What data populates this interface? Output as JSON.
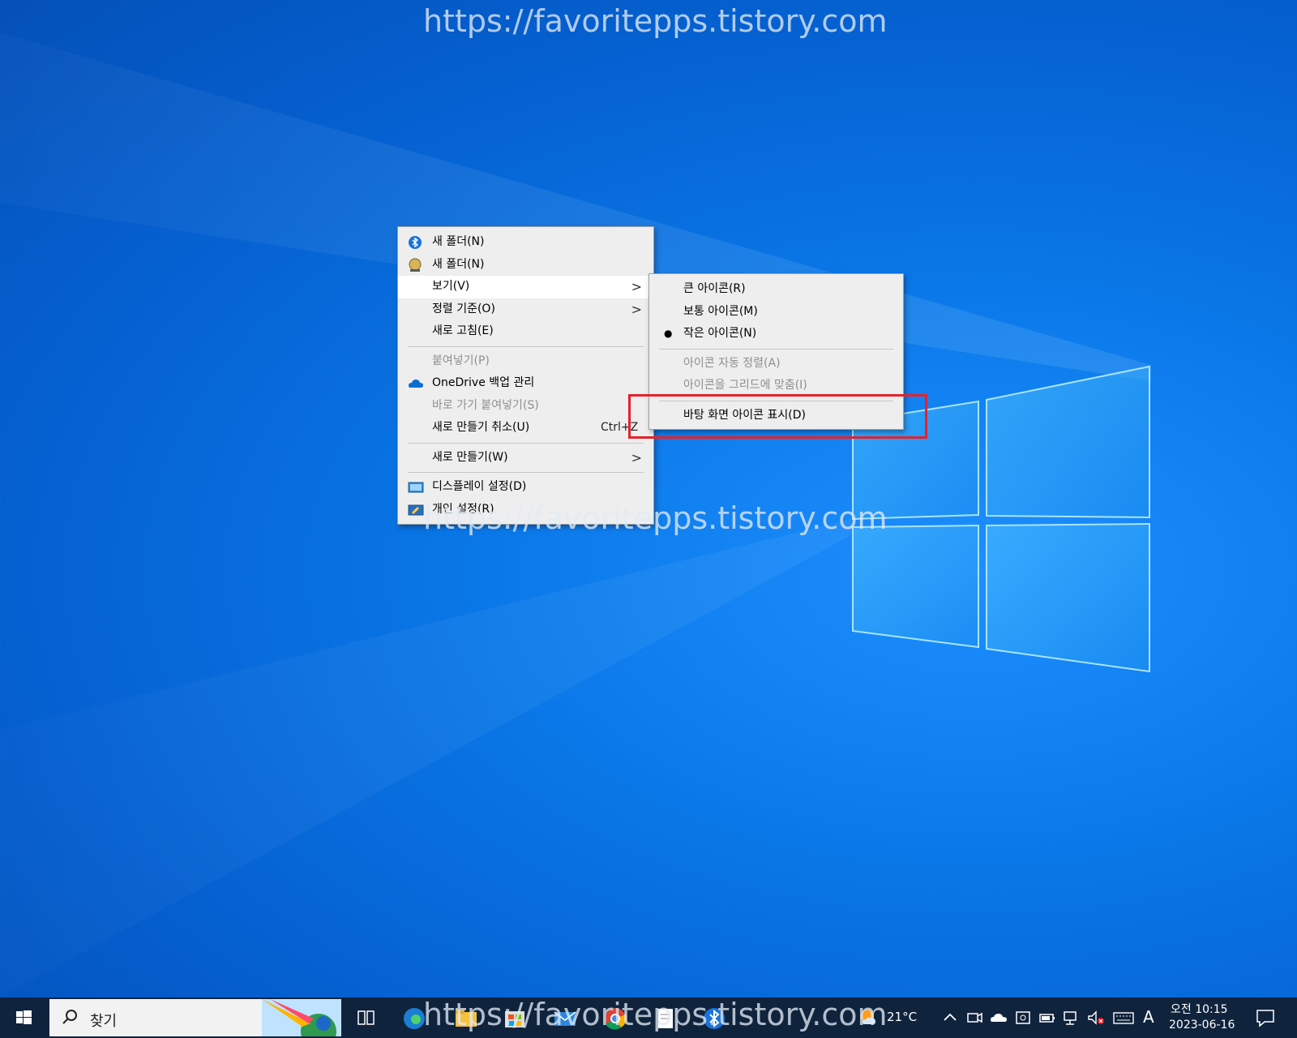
{
  "watermark": "https://favoritepps.tistory.com",
  "context_menu": {
    "items": [
      {
        "label": "새 폴더(N)"
      },
      {
        "label": "새 폴더(N)"
      },
      {
        "label": "보기(V)"
      },
      {
        "label": "정렬 기준(O)"
      },
      {
        "label": "새로 고침(E)"
      },
      {
        "label": "붙여넣기(P)"
      },
      {
        "label": "OneDrive 백업 관리"
      },
      {
        "label": "바로 가기 붙여넣기(S)"
      },
      {
        "label": "새로 만들기 취소(U)",
        "shortcut": "Ctrl+Z"
      },
      {
        "label": "새로 만들기(W)"
      },
      {
        "label": "디스플레이 설정(D)"
      },
      {
        "label": "개인 설정(R)"
      }
    ]
  },
  "view_submenu": {
    "items": [
      {
        "label": "큰 아이콘(R)"
      },
      {
        "label": "보통 아이콘(M)"
      },
      {
        "label": "작은 아이콘(N)",
        "checked_mark": "●"
      },
      {
        "label": "아이콘 자동 정렬(A)"
      },
      {
        "label": "아이콘을 그리드에 맞춤(I)"
      },
      {
        "label": "바탕 화면 아이콘 표시(D)"
      }
    ]
  },
  "taskbar": {
    "search_label": "찾기",
    "weather_temp": "21°C",
    "ime_indicator": "A",
    "clock_time": "오전 10:15",
    "clock_date": "2023-06-16"
  },
  "colors": {
    "highlight_box": "#e8202a",
    "taskbar_bg": "#10233d",
    "menu_bg": "#eeeeee"
  }
}
